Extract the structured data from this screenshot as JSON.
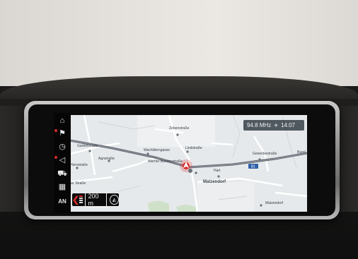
{
  "status_bar": {
    "radio": "94.8 MHz",
    "time": "14:07"
  },
  "side_menu": [
    {
      "id": "home",
      "icon": "home-icon",
      "glyph": "⌂"
    },
    {
      "id": "navigation",
      "icon": "flag-icon",
      "glyph": "⚑"
    },
    {
      "id": "clock",
      "icon": "clock-icon",
      "glyph": "◷"
    },
    {
      "id": "audio",
      "icon": "speaker-icon",
      "glyph": "◁"
    },
    {
      "id": "phone",
      "icon": "car-icon",
      "glyph": "⛟"
    },
    {
      "id": "map",
      "icon": "map-icon",
      "glyph": "▦"
    },
    {
      "id": "assist",
      "label": "AN"
    }
  ],
  "map": {
    "streets": {
      "zebenstrasse": "Zebenstraße",
      "wachlderngasse": "Wachlderngasse",
      "lindstrasse": "Lindstraße",
      "werner_bundes": "Werner Bundesstraße",
      "gewerbestrasse": "Gewerbestraße",
      "agnstrasse": "Agnstraße",
      "gartenstrasse": "Gartenstraße",
      "hornstrasse": "Hornstraße",
      "dorfstrasse": "ter Straße",
      "hart": "Hart",
      "matzendorf": "Matzendorf",
      "matzendorf2": "Matzendorf",
      "bund": "Bund"
    },
    "road_shield": "B1",
    "scale": "200 m"
  },
  "colors": {
    "accent_red": "#d92b2b",
    "map_bg": "#e5e8ea",
    "road_shield": "#2e5fa8"
  }
}
